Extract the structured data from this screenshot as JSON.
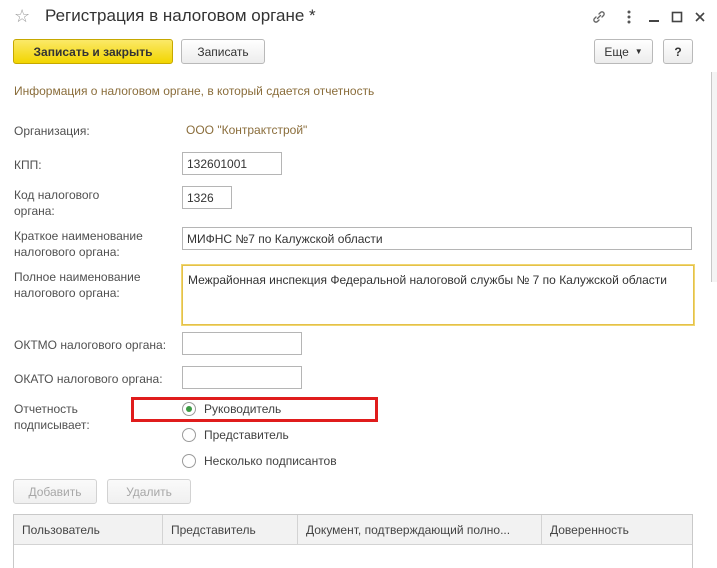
{
  "window": {
    "title": "Регистрация в налоговом органе *",
    "icons": [
      "star-icon",
      "link-icon",
      "more-icon",
      "minimize-icon",
      "maximize-icon",
      "close-icon"
    ]
  },
  "toolbar": {
    "save_close_label": "Записать и закрыть",
    "save_label": "Записать",
    "more_label": "Еще",
    "help_label": "?"
  },
  "info_text": "Информация о налоговом органе, в который сдается отчетность",
  "form": {
    "organization_label": "Организация:",
    "organization_value": "ООО \"Контрактстрой\"",
    "kpp_label": "КПП:",
    "kpp_value": "132601001",
    "tax_code_label_1": "Код налогового",
    "tax_code_label_2": "органа:",
    "tax_code_value": "1326",
    "short_name_label_1": "Краткое наименование",
    "short_name_label_2": "налогового органа:",
    "short_name_value": "МИФНС №7 по Калужской области",
    "full_name_label_1": "Полное наименование",
    "full_name_label_2": "налогового органа:",
    "full_name_value": "Межрайонная инспекция Федеральной налоговой службы № 7 по Калужской области",
    "oktmo_label": "ОКТМО налогового органа:",
    "oktmo_value": "",
    "okato_label": "ОКАТО налогового органа:",
    "okato_value": "",
    "signer_label_1": "Отчетность",
    "signer_label_2": "подписывает:",
    "signer_options": [
      {
        "label": "Руководитель",
        "checked": true
      },
      {
        "label": "Представитель",
        "checked": false
      },
      {
        "label": "Несколько подписантов",
        "checked": false
      }
    ]
  },
  "table_toolbar": {
    "add_label": "Добавить",
    "delete_label": "Удалить"
  },
  "table": {
    "columns": [
      "Пользователь",
      "Представитель",
      "Документ, подтверждающий полно...",
      "Доверенность"
    ]
  },
  "colors": {
    "accent_yellow": "#f2d500",
    "link_brown": "#8a6d3b",
    "highlight_red": "#e01c1c",
    "radio_green": "#3c9a44"
  }
}
